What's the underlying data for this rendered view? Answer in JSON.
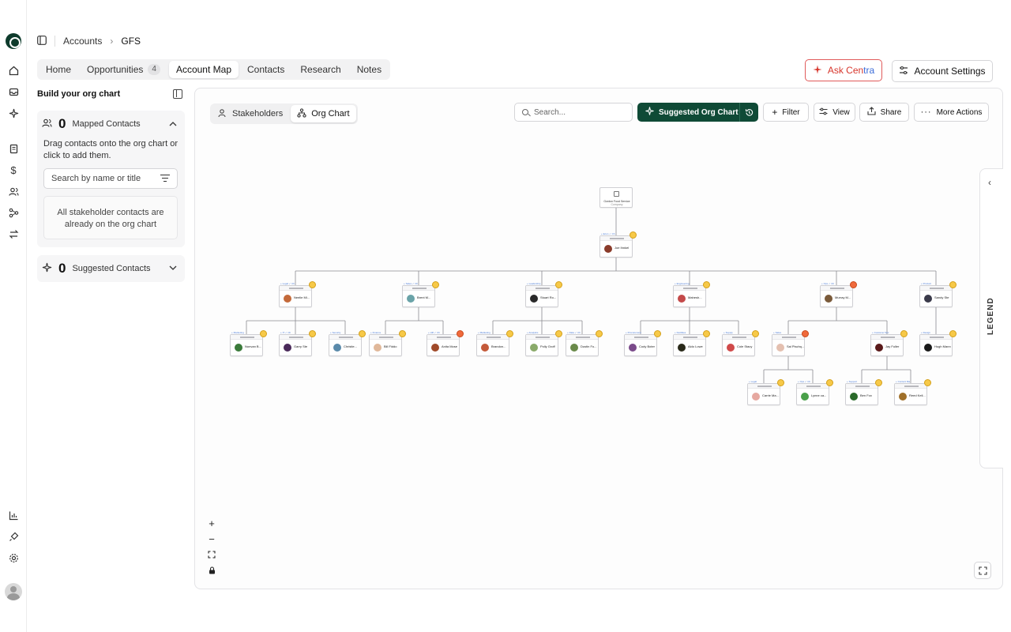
{
  "breadcrumb": {
    "root": "Accounts",
    "current": "GFS"
  },
  "tabs": [
    {
      "label": "Home"
    },
    {
      "label": "Opportunities",
      "badge": "4"
    },
    {
      "label": "Account Map"
    },
    {
      "label": "Contacts"
    },
    {
      "label": "Research"
    },
    {
      "label": "Notes"
    }
  ],
  "header": {
    "ask_prefix": "Ask Cen",
    "ask_suffix": "tra",
    "settings": "Account Settings"
  },
  "panel": {
    "title": "Build your org chart",
    "mapped": {
      "count": "0",
      "label": "Mapped Contacts",
      "description": "Drag contacts onto the org chart or click to add them.",
      "search_placeholder": "Search by name or title",
      "empty": "All stakeholder contacts are already on the org chart"
    },
    "suggested": {
      "count": "0",
      "label": "Suggested Contacts"
    }
  },
  "canvas": {
    "views": [
      "Stakeholders",
      "Org Chart"
    ],
    "search_placeholder": "Search...",
    "suggested_button": "Suggested Org Chart",
    "filter": "Filter",
    "view": "View",
    "share": "Share",
    "more": "More Actions",
    "legend": "LEGEND"
  },
  "icons": {
    "accent": "#0f4a36",
    "ask": "#d7352b"
  },
  "org": {
    "root": {
      "label": "Gordon Food Service",
      "sub": "Company"
    },
    "people": [
      {
        "name": "Joe Ihnkel"
      },
      {
        "name": "Neelie Mi..."
      },
      {
        "name": "Brent M..."
      },
      {
        "name": "Stuart Ro..."
      },
      {
        "name": "Mahesh..."
      },
      {
        "name": "Murray M..."
      },
      {
        "name": "Sandy Ste"
      },
      {
        "name": "Nonvan B..."
      },
      {
        "name": "Garry Ste"
      },
      {
        "name": "Christie..."
      },
      {
        "name": "Bill Fiddo"
      },
      {
        "name": "Anita Mose"
      },
      {
        "name": "Brandon..."
      },
      {
        "name": "Polly Groff"
      },
      {
        "name": "Dustin Fo..."
      },
      {
        "name": "Cody Boter"
      },
      {
        "name": "Aldo Lowe"
      },
      {
        "name": "Cole Stacy"
      },
      {
        "name": "Sal Pischq..."
      },
      {
        "name": "Jay Fuller"
      },
      {
        "name": "Hugh Mann"
      },
      {
        "name": "Carrie Ma..."
      },
      {
        "name": "Lynne ca..."
      },
      {
        "name": "Ben Fox"
      },
      {
        "name": "Reed Kell..."
      }
    ]
  }
}
